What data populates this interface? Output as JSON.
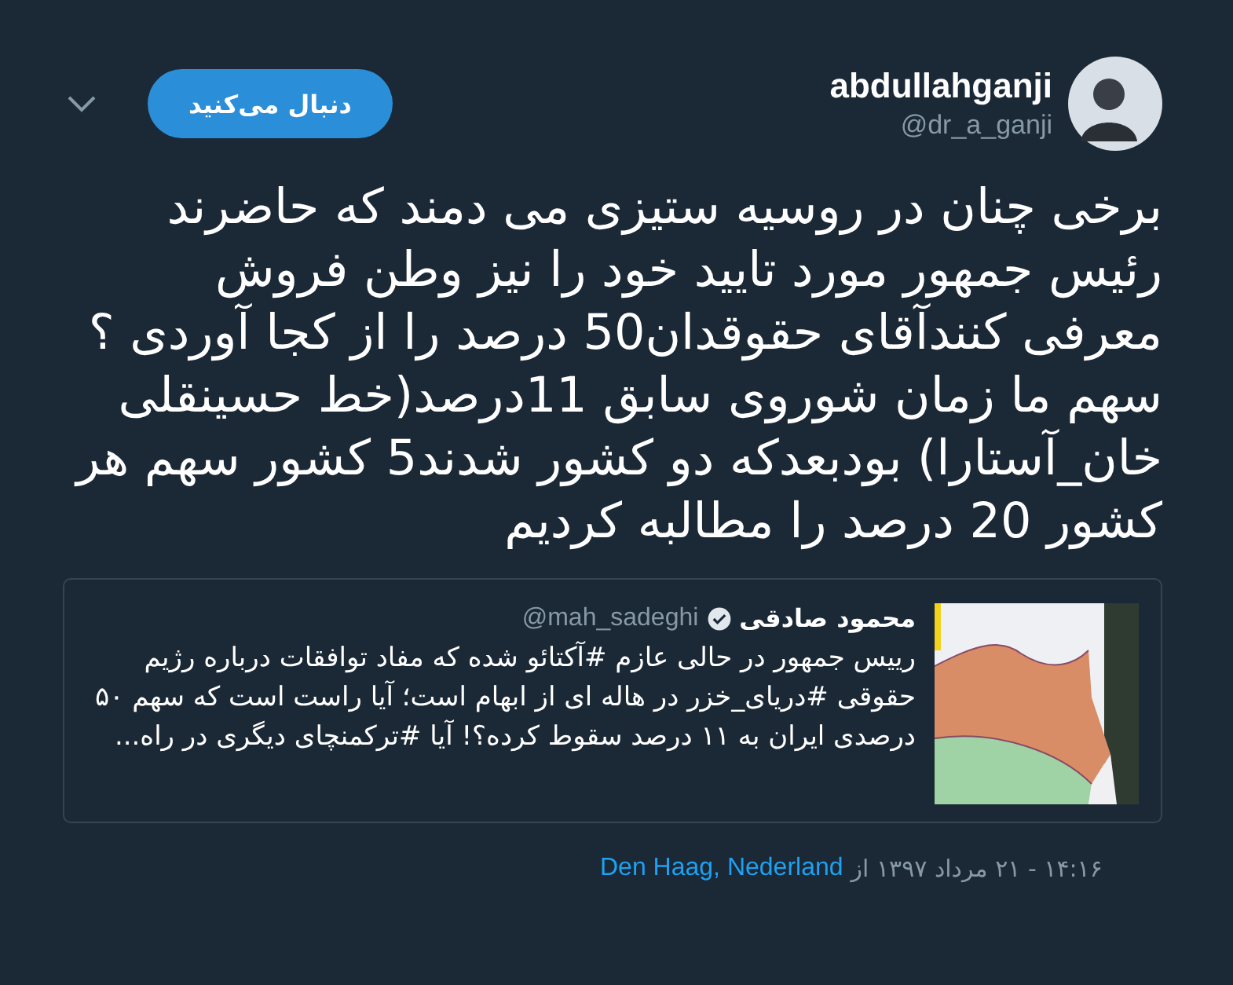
{
  "author": {
    "name": "abdullahganji",
    "handle": "@dr_a_ganji"
  },
  "follow_button": {
    "label": "دنبال می‌کنید"
  },
  "tweet_text": "برخی چنان در روسیه ستیزی می دمند که حاضرند رئیس جمهور مورد تایید خود را نیز وطن فروش معرفی کنندآقای حقوقدان50 درصد را از کجا آوردی ؟سهم ما زمان شوروی سابق 11درصد(خط حسینقلی خان_آستارا) بودبعدکه دو کشور شدند5 کشور سهم هر کشور 20 درصد را مطالبه کردیم",
  "quoted_tweet": {
    "name": "محمود صادقی",
    "verified": true,
    "handle": "@mah_sadeghi",
    "text": "رییس جمهور در حالی عازم #آکتائو شده که مفاد توافقات درباره رژیم حقوقی #دریای_خزر در هاله ای از ابهام است؛ آیا راست است که سهم ۵۰ درصدی ایران به ۱۱ درصد سقوط کرده؟! آیا #ترکمنچای دیگری در راه..."
  },
  "timestamp": "۱۴:۱۶ - ۲۱ مرداد ۱۳۹۷ از",
  "location": "Den Haag, Nederland"
}
